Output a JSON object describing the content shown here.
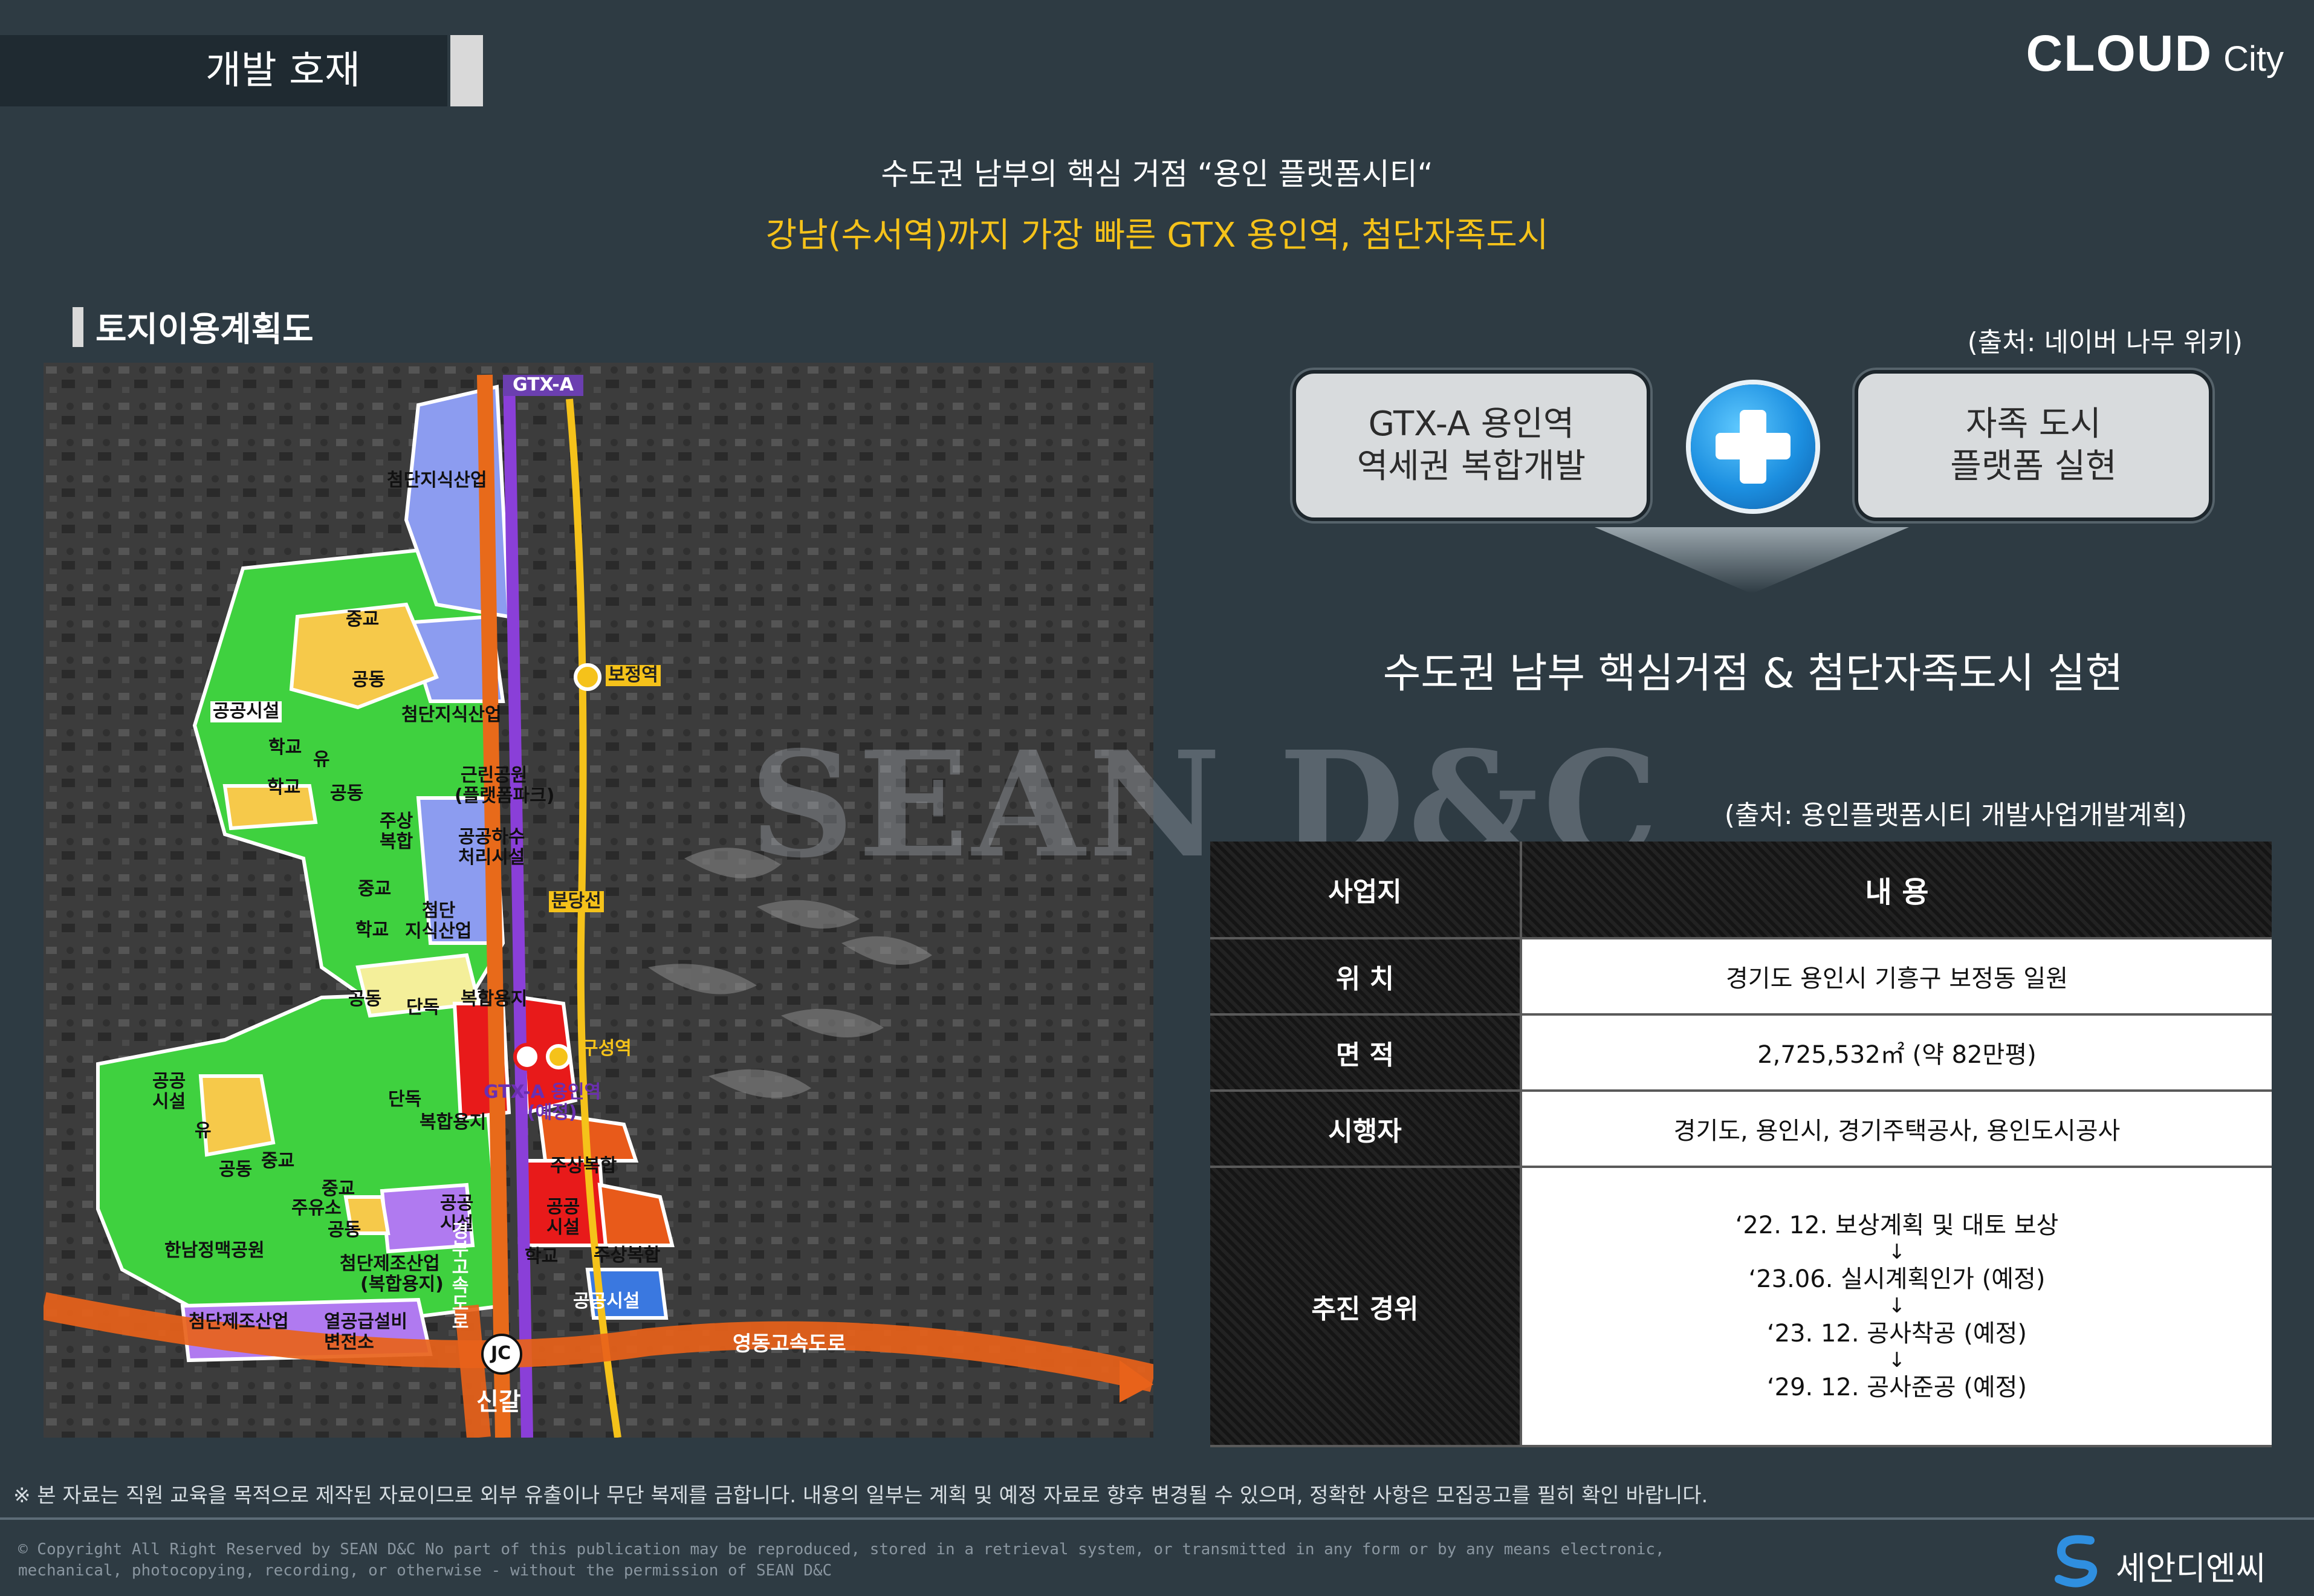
{
  "header": {
    "section_title": "개발 호재",
    "brand_main": "CLOUD",
    "brand_sub": "City"
  },
  "headline": {
    "line1": "수도권 남부의 핵심 거점 “용인 플랫폼시티“",
    "line2": "강남(수서역)까지 가장 빠른 GTX 용인역, 첨단자족도시"
  },
  "land_use": {
    "title": "토지이용계획도",
    "labels": {
      "gtx_a": "GTX-A",
      "tech_industry_top": "첨단지식산업",
      "middle_school_1": "중교",
      "housing_1": "공동",
      "public_facility_1": "공공시설",
      "tech_industry_mid": "첨단지식산업",
      "school_kinder_1": "학교",
      "kinder_1": "유",
      "school_1": "학교",
      "housing_2": "공동",
      "park": "근린공원",
      "park_sub": "(플랫폼파크)",
      "mixed_1": "주상",
      "mixed_1b": "복합",
      "sewage": "공공하수",
      "sewage_b": "처리시설",
      "middle_school_2": "중교",
      "tech_2": "첨단",
      "tech_2b": "지식산업",
      "school_2": "학교",
      "housing_3": "공동",
      "detached_1": "단독",
      "mixed_use_1": "복합용지",
      "detached_2": "단독",
      "mixed_use_2": "복합용지",
      "public_2": "공공",
      "public_2b": "시설",
      "kinder_2": "유",
      "housing_4": "공동",
      "middle_school_3": "중교",
      "middle_school_4": "중교",
      "gas_station": "주유소",
      "housing_5": "공동",
      "public_3": "공공",
      "public_3b": "시설",
      "hannam_park": "한남정맥공원",
      "tech_manufacture": "첨단제조산업",
      "tech_manufacture_b": "(복합용지)",
      "tech_manufacture_2": "첨단제조산업",
      "heat_supply": "열공급설비",
      "substation": "변전소",
      "mixed_2": "주상복합",
      "public_4": "공공",
      "public_4b": "시설",
      "mixed_3": "주상복합",
      "school_3": "학교",
      "public_facility_5": "공공시설",
      "bojeong_station": "보정역",
      "bundang_line": "분당선",
      "guseong_station": "구성역",
      "gtx_yongin": "GTX-A 용인역",
      "gtx_yongin_sub": "(예정)",
      "expressway_north": "경부고속도로",
      "expressway_east": "영동고속도로",
      "jc": "JC",
      "singal": "신갈"
    }
  },
  "panel": {
    "source_top": "(출처: 네이버 나무 위키)",
    "pill_left_line1": "GTX-A 용인역",
    "pill_left_line2": "역세권 복합개발",
    "pill_right_line1": "자족 도시",
    "pill_right_line2": "플랫폼 실현",
    "goal": "수도권 남부 핵심거점 & 첨단자족도시 실현",
    "source_table": "(출처: 용인플랫폼시티 개발사업개발계획)"
  },
  "table": {
    "col_header_1": "사업지",
    "col_header_2": "내 용",
    "rows": [
      {
        "label": "위 치",
        "value": "경기도 용인시 기흥구 보정동 일원"
      },
      {
        "label": "면 적",
        "value": "2,725,532㎡ (약 82만평)"
      },
      {
        "label": "시행자",
        "value": "경기도, 용인시, 경기주택공사, 용인도시공사"
      }
    ],
    "timeline_label": "추진 경위",
    "timeline": [
      "‘22. 12. 보상계획 및 대토 보상",
      "‘23.06. 실시계획인가 (예정)",
      "‘23. 12. 공사착공 (예정)",
      "‘29. 12. 공사준공 (예정)"
    ],
    "arrow": "↓"
  },
  "footer": {
    "disclaimer": "※ 본 자료는 직원 교육을 목적으로 제작된 자료이므로 외부 유출이나 무단 복제를 금합니다. 내용의 일부는 계획 및 예정 자료로 향후 변경될 수 있으며, 정확한 사항은 모집공고를 필히 확인 바랍니다.",
    "copyright": "© Copyright All Right Reserved by SEAN D&C  No part of this publication may be reproduced, stored in a retrieval system, or transmitted in any form or by any means electronic, mechanical, photocopying, recording, or otherwise - without the permission of SEAN D&C",
    "company": "세안디엔씨",
    "watermark": "SEAN D&C"
  },
  "colors": {
    "background": "#2e3b43",
    "accent_yellow": "#f5c21a",
    "plus_blue": "#1c8fe0"
  }
}
